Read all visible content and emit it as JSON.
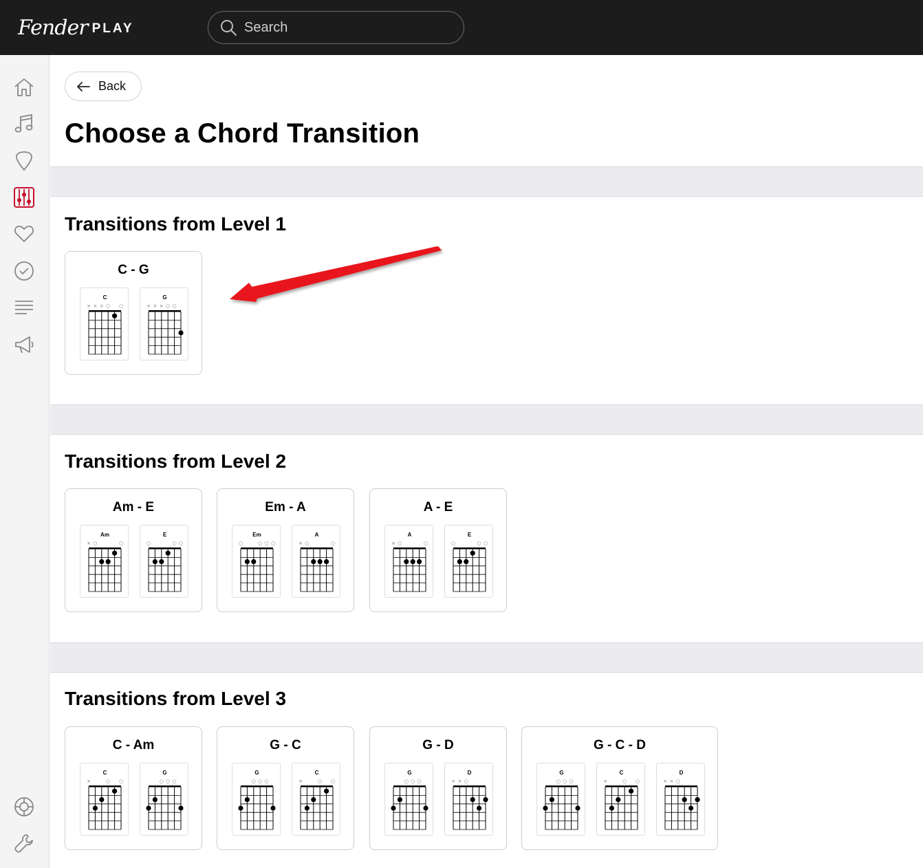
{
  "header": {
    "logo_script": "Fender",
    "logo_play": "PLAY",
    "search_placeholder": "Search"
  },
  "sidebar": {
    "items": [
      {
        "icon": "home-icon",
        "active": false
      },
      {
        "icon": "music-note-icon",
        "active": false
      },
      {
        "icon": "guitar-pick-icon",
        "active": false
      },
      {
        "icon": "chord-tools-icon",
        "active": true
      },
      {
        "icon": "heart-icon",
        "active": false
      },
      {
        "icon": "check-circle-icon",
        "active": false
      },
      {
        "icon": "list-icon",
        "active": false
      },
      {
        "icon": "megaphone-icon",
        "active": false
      }
    ],
    "bottom_items": [
      {
        "icon": "lifebuoy-icon"
      },
      {
        "icon": "wrench-icon"
      }
    ],
    "active_color": "#c8102e"
  },
  "back_button": {
    "label": "Back"
  },
  "page_title": "Choose a Chord Transition",
  "sections": [
    {
      "title": "Transitions from Level 1",
      "cards": [
        {
          "title": "C - G",
          "chords": [
            "C",
            "G"
          ]
        }
      ]
    },
    {
      "title": "Transitions from Level 2",
      "cards": [
        {
          "title": "Am - E",
          "chords": [
            "Am",
            "E"
          ]
        },
        {
          "title": "Em - A",
          "chords": [
            "Em",
            "A"
          ]
        },
        {
          "title": "A - E",
          "chords": [
            "A",
            "E"
          ]
        }
      ]
    },
    {
      "title": "Transitions from Level 3",
      "cards": [
        {
          "title": "C - Am",
          "chords": [
            "C",
            "G"
          ]
        },
        {
          "title": "G - C",
          "chords": [
            "G",
            "C"
          ]
        },
        {
          "title": "G - D",
          "chords": [
            "G",
            "D"
          ]
        },
        {
          "title": "G - C - D",
          "chords": [
            "G",
            "C",
            "D"
          ]
        }
      ]
    }
  ],
  "annotation": {
    "arrow_color": "#e8141b"
  }
}
